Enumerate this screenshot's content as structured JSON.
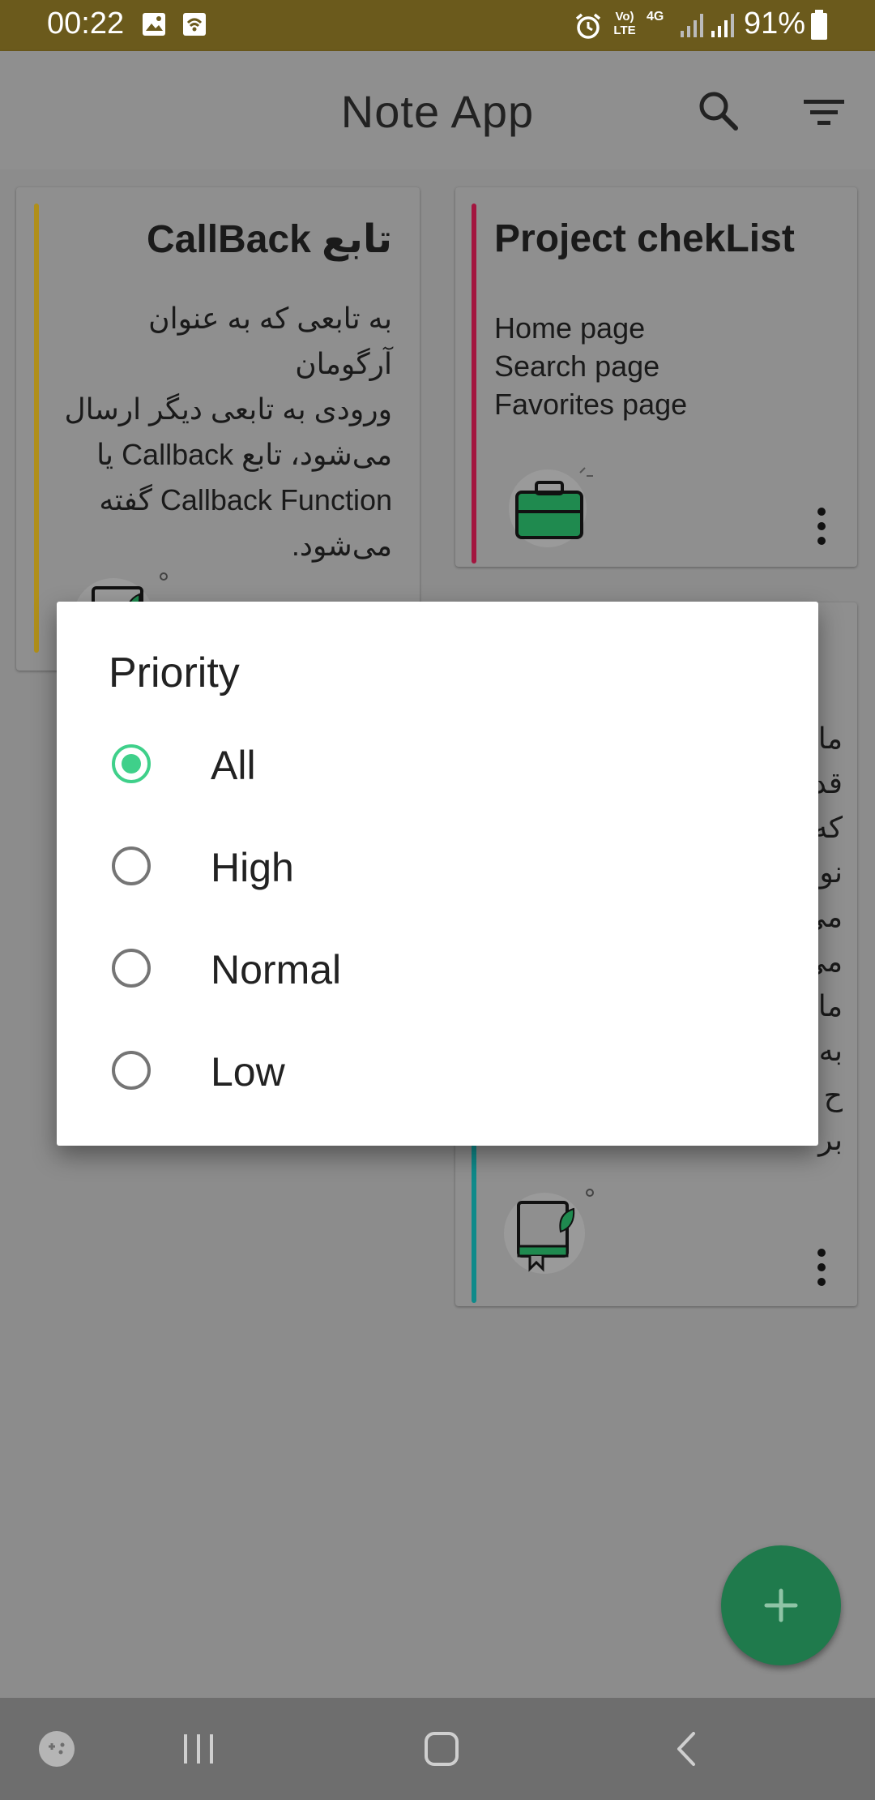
{
  "status_bar": {
    "time": "00:22",
    "battery": "91%",
    "lte_label": "Vo) LTE",
    "network_label": "4G"
  },
  "app_bar": {
    "title": "Note App",
    "search_icon": "search-icon",
    "filter_icon": "filter-icon"
  },
  "notes": [
    {
      "title": "تابع CallBack",
      "body": "به تابعی که به عنوان آرگومان\nورودی به تابعی دیگر ارسال\nمی‌شود، تابع Callback یا\nCallback Function گفته\nمی‌شود.",
      "accent_color": "#b08f1a",
      "icon": "book-leaf-icon"
    },
    {
      "title": "Project chekList",
      "body": "Home page\nSearch page\n Favorites page",
      "accent_color": "#a3153f",
      "icon": "briefcase-icon"
    },
    {
      "title": "",
      "body": "ما\nقد\nکه\nنو\nمی\nمی\nما\nبه\nح\nبر",
      "accent_color": "#0f8a8a",
      "icon": "book-leaf-icon"
    }
  ],
  "fab": {
    "label": "+"
  },
  "dialog": {
    "title": "Priority",
    "options": [
      {
        "label": "All",
        "selected": true
      },
      {
        "label": "High",
        "selected": false
      },
      {
        "label": "Normal",
        "selected": false
      },
      {
        "label": "Low",
        "selected": false
      }
    ],
    "accent_color": "#3fd08a"
  },
  "nav_bar": {
    "game_icon": "game-launcher-icon",
    "recents_icon": "recents-icon",
    "home_icon": "home-icon",
    "back_icon": "back-icon"
  }
}
